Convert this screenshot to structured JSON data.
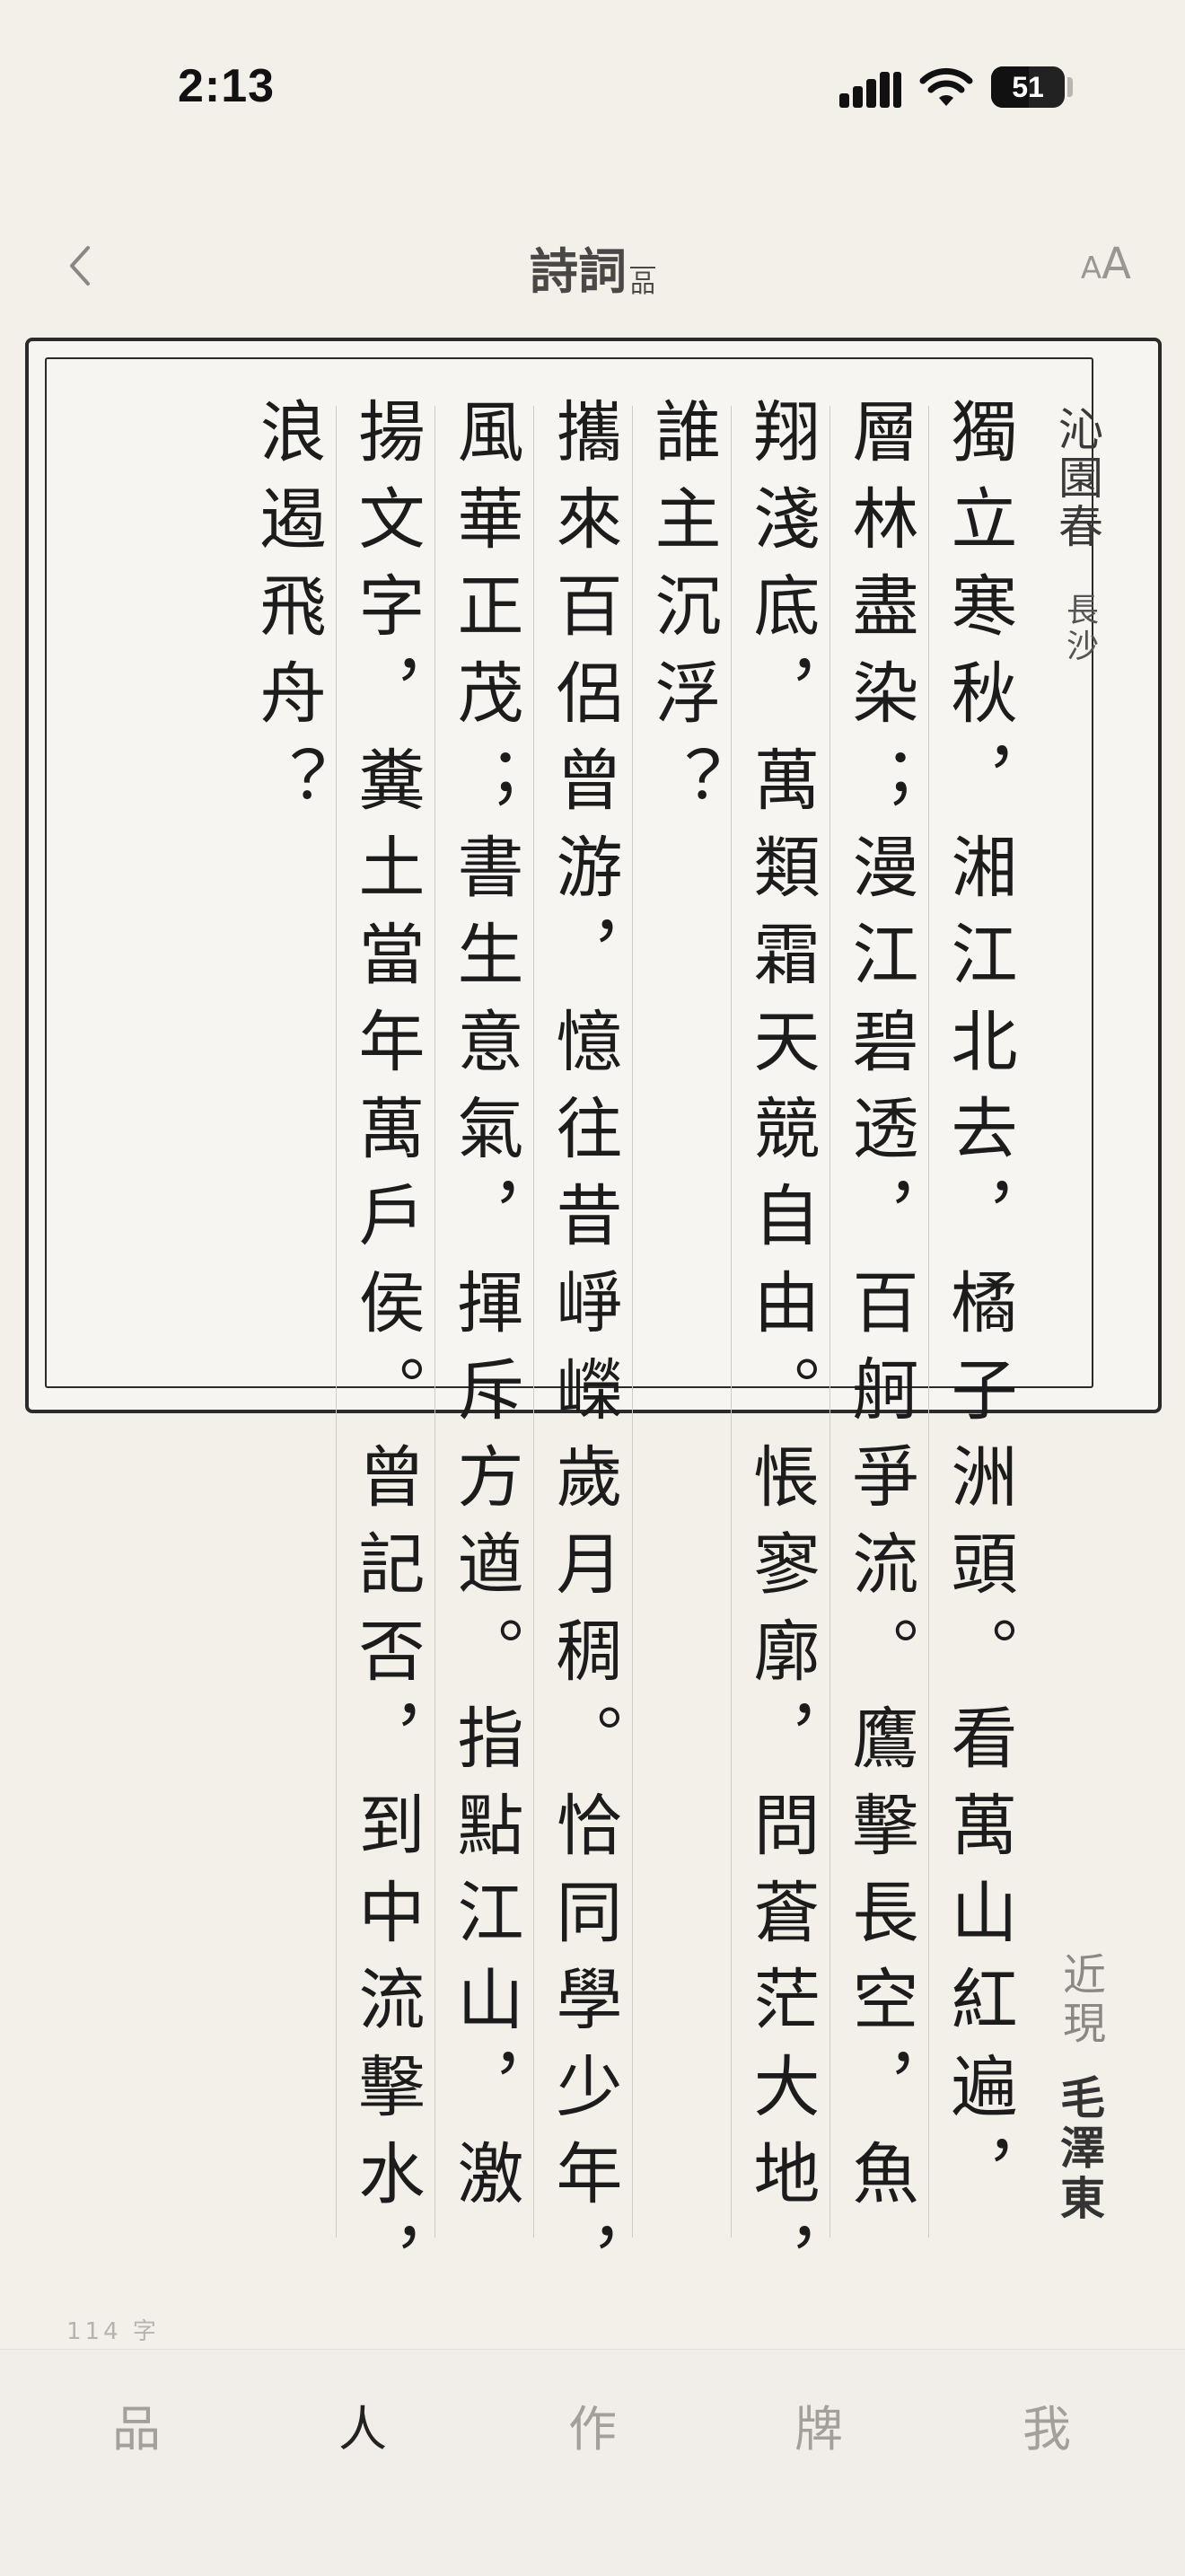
{
  "status_bar": {
    "time": "2:13",
    "battery_level": "51"
  },
  "nav": {
    "back_icon": "chevron-left-icon",
    "title": "詩詞",
    "title_sub": "品",
    "font_small": "A",
    "font_large": "A"
  },
  "poem": {
    "title": "沁園春",
    "subtitle": "長沙",
    "era": "近現",
    "author": "毛澤東",
    "columns": [
      "獨立寒秋，湘江北去，橘子洲頭。看萬山紅遍，",
      "層林盡染；漫江碧透，百舸爭流。鷹擊長空，魚",
      "翔淺底，萬類霜天競自由。悵寥廓，問蒼茫大地，",
      "誰主沉浮？",
      "攜來百侶曾游，憶往昔崢嶸歲月稠。恰同學少年，",
      "風華正茂；書生意氣，揮斥方遒。指點江山，激",
      "揚文字，糞土當年萬戶侯。曾記否，到中流擊水，",
      "浪遏飛舟？"
    ],
    "word_count": "114 字"
  },
  "tabs": [
    {
      "label": "品",
      "active": false
    },
    {
      "label": "人",
      "active": true
    },
    {
      "label": "作",
      "active": false
    },
    {
      "label": "牌",
      "active": false
    },
    {
      "label": "我",
      "active": false
    }
  ]
}
